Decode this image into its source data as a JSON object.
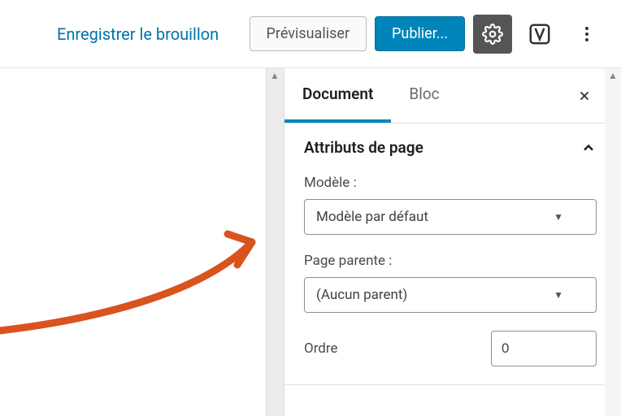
{
  "toolbar": {
    "save_draft": "Enregistrer le brouillon",
    "preview": "Prévisualiser",
    "publish": "Publier..."
  },
  "sidebar": {
    "tabs": {
      "document": "Document",
      "bloc": "Bloc"
    },
    "panel": {
      "title": "Attributs de page",
      "template_label": "Modèle :",
      "template_value": "Modèle par défaut",
      "parent_label": "Page parente :",
      "parent_value": "(Aucun parent)",
      "order_label": "Ordre",
      "order_value": "0"
    }
  }
}
